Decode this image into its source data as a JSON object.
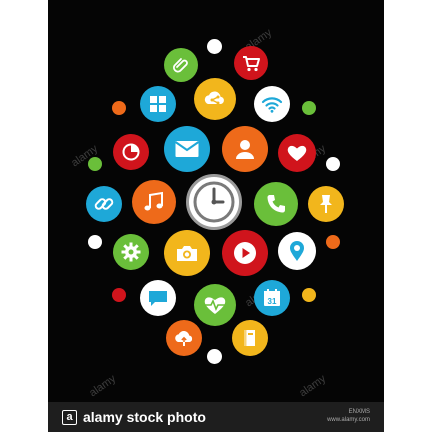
{
  "colors": {
    "background": "#050505",
    "green": "#6abf3a",
    "red": "#d0141c",
    "orange": "#ee6a1a",
    "yellow": "#f2b61c",
    "blue": "#1ea8d8",
    "white": "#ffffff",
    "gray": "#9a9a9a"
  },
  "apps": [
    {
      "name": "paperclip-icon",
      "color": "#6abf3a"
    },
    {
      "name": "shopping-cart-icon",
      "color": "#d0141c"
    },
    {
      "name": "grid-icon",
      "color": "#1ea8d8"
    },
    {
      "name": "cloud-share-icon",
      "color": "#f2b61c"
    },
    {
      "name": "wifi-icon",
      "color": "#ffffff"
    },
    {
      "name": "pie-chart-icon",
      "color": "#d0141c"
    },
    {
      "name": "mail-icon",
      "color": "#1ea8d8"
    },
    {
      "name": "user-icon",
      "color": "#ee6a1a"
    },
    {
      "name": "heart-icon",
      "color": "#d0141c"
    },
    {
      "name": "link-icon",
      "color": "#1ea8d8"
    },
    {
      "name": "music-note-icon",
      "color": "#ee6a1a"
    },
    {
      "name": "clock-icon",
      "color": "#ffffff"
    },
    {
      "name": "phone-icon",
      "color": "#6abf3a"
    },
    {
      "name": "pushpin-icon",
      "color": "#f2b61c"
    },
    {
      "name": "settings-gear-icon",
      "color": "#6abf3a"
    },
    {
      "name": "camera-icon",
      "color": "#f2b61c"
    },
    {
      "name": "play-icon",
      "color": "#d0141c"
    },
    {
      "name": "map-pin-icon",
      "color": "#ffffff"
    },
    {
      "name": "chat-bubble-icon",
      "color": "#ffffff"
    },
    {
      "name": "heartbeat-icon",
      "color": "#6abf3a"
    },
    {
      "name": "calendar-icon",
      "color": "#1ea8d8"
    },
    {
      "name": "cloud-upload-icon",
      "color": "#ee6a1a"
    },
    {
      "name": "book-icon",
      "color": "#f2b61c"
    }
  ],
  "calendar_day": "31",
  "watermark": {
    "text": "alamy",
    "footer_logo": "a",
    "footer_text": "alamy stock photo",
    "image_id": "ENXMS",
    "site": "www.alamy.com"
  }
}
